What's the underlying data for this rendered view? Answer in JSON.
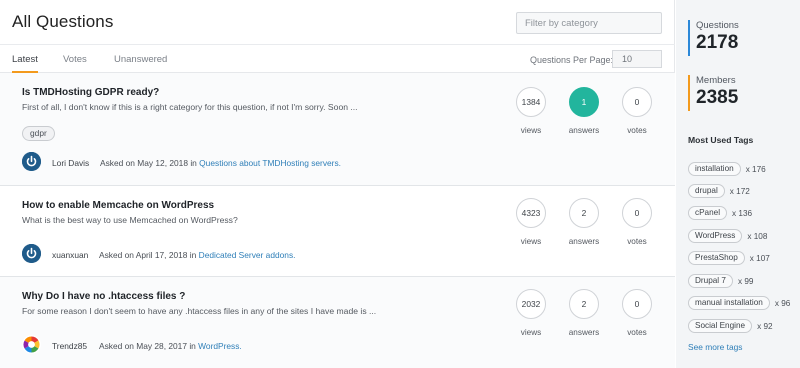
{
  "page": {
    "title": "All Questions",
    "filter_placeholder": "Filter by category"
  },
  "tabs": [
    {
      "label": "Latest",
      "active": true
    },
    {
      "label": "Votes",
      "active": false
    },
    {
      "label": "Unanswered",
      "active": false
    }
  ],
  "per_page": {
    "label": "Questions Per Page:",
    "value": "10"
  },
  "stat_labels": {
    "views": "views",
    "answers": "answers",
    "votes": "votes"
  },
  "questions": [
    {
      "title": "Is TMDHosting GDPR ready?",
      "excerpt": "First of all, I don't know if this is a right category for this question, if not I'm sorry. Soon ...",
      "tag": "gdpr",
      "author": "Lori Davis",
      "asked": "Asked on May 12, 2018 in ",
      "category": "Questions about TMDHosting servers.",
      "views": "1384",
      "answers": "1",
      "votes": "0",
      "answered": true,
      "avatar_icon": "power-icon"
    },
    {
      "title": "How to enable Memcache on WordPress",
      "excerpt": "What is the best way to use Memcached on WordPress?",
      "author": "xuanxuan",
      "asked": "Asked on April 17, 2018 in ",
      "category": "Dedicated Server addons.",
      "views": "4323",
      "answers": "2",
      "votes": "0",
      "answered": false,
      "avatar_icon": "power-icon"
    },
    {
      "title": "Why Do I have no .htaccess files ?",
      "excerpt": "For some reason I don't seem to have any .htaccess files in any of the sites I have made is ...",
      "author": "Trendz85",
      "asked": "Asked on May 28, 2017 in ",
      "category": "WordPress.",
      "views": "2032",
      "answers": "2",
      "votes": "0",
      "answered": false,
      "avatar_icon": "pinwheel-icon"
    }
  ],
  "sidebar": {
    "questions_label": "Questions",
    "questions_count": "2178",
    "members_label": "Members",
    "members_count": "2385",
    "most_used_heading": "Most Used Tags",
    "tags": [
      {
        "name": "installation",
        "count": "x 176"
      },
      {
        "name": "drupal",
        "count": "x 172"
      },
      {
        "name": "cPanel",
        "count": "x 136"
      },
      {
        "name": "WordPress",
        "count": "x 108"
      },
      {
        "name": "PrestaShop",
        "count": "x 107"
      },
      {
        "name": "Drupal 7",
        "count": "x 99"
      },
      {
        "name": "manual installation",
        "count": "x 96"
      },
      {
        "name": "Social Engine",
        "count": "x 92"
      }
    ],
    "see_more": "See more tags"
  },
  "colors": {
    "accent_orange": "#f39a1d",
    "accent_blue": "#2b88d8",
    "answered_green": "#22b59d",
    "link_blue": "#2f7fb8"
  }
}
